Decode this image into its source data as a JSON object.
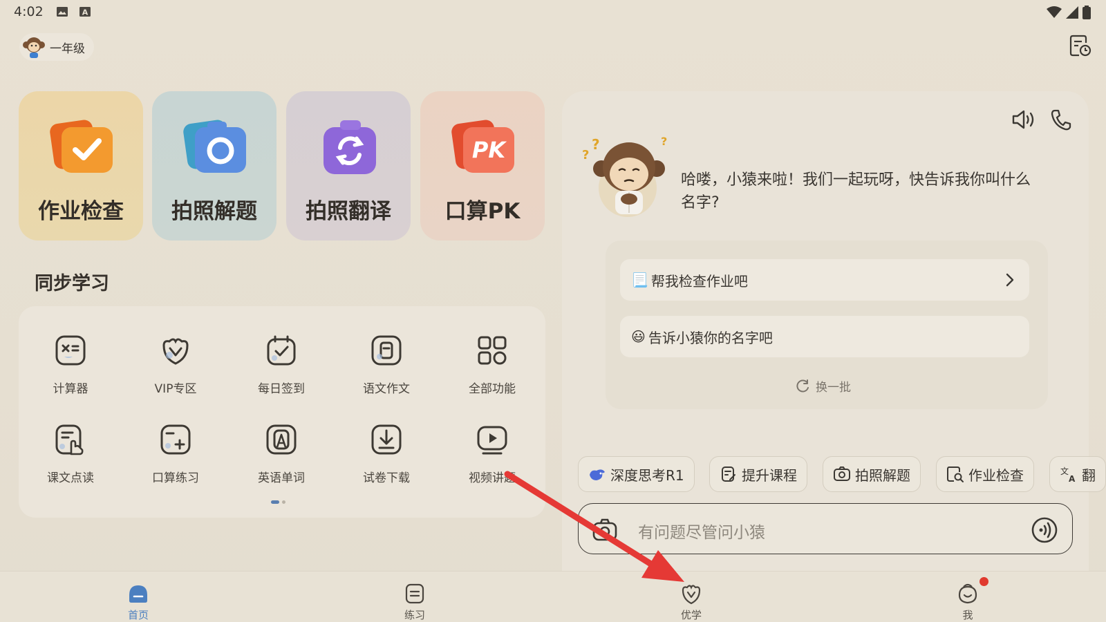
{
  "status_bar": {
    "time": "4:02"
  },
  "header": {
    "grade_label": "一年级"
  },
  "feature_cards": [
    {
      "label": "作业检查",
      "icon": "check-folder-icon",
      "color": "#f08a2a"
    },
    {
      "label": "拍照解题",
      "icon": "camera-icon",
      "color": "#4f8ad6"
    },
    {
      "label": "拍照翻译",
      "icon": "camera-refresh-icon",
      "color": "#9a6fd8"
    },
    {
      "label": "口算PK",
      "icon": "pk-icon",
      "color": "#f0745a",
      "badge_text": "PK"
    }
  ],
  "sync": {
    "title": "同步学习",
    "items": [
      {
        "label": "计算器",
        "icon": "calculator-icon"
      },
      {
        "label": "VIP专区",
        "icon": "vip-icon"
      },
      {
        "label": "每日签到",
        "icon": "calendar-check-icon"
      },
      {
        "label": "语文作文",
        "icon": "essay-icon"
      },
      {
        "label": "全部功能",
        "icon": "grid-apps-icon"
      },
      {
        "label": "课文点读",
        "icon": "read-aloud-icon"
      },
      {
        "label": "口算练习",
        "icon": "plus-box-icon"
      },
      {
        "label": "英语单词",
        "icon": "letter-a-icon"
      },
      {
        "label": "试卷下载",
        "icon": "download-icon"
      },
      {
        "label": "视频讲题",
        "icon": "video-icon"
      }
    ]
  },
  "chat": {
    "greeting": "哈喽，小猿来啦！我们一起玩呀，快告诉我你叫什么名字?",
    "suggestions": [
      {
        "emoji": "📃",
        "text": "帮我检查作业吧"
      },
      {
        "emoji": "😃",
        "text": "告诉小猿你的名字吧"
      }
    ],
    "refresh_label": "换一批",
    "chips": [
      {
        "label": "深度思考R1",
        "icon": "deepseek-icon"
      },
      {
        "label": "提升课程",
        "icon": "course-icon"
      },
      {
        "label": "拍照解题",
        "icon": "camera-icon"
      },
      {
        "label": "作业检查",
        "icon": "doc-search-icon"
      },
      {
        "label": "翻",
        "icon": "translate-icon"
      }
    ],
    "input_placeholder": "有问题尽管问小猿"
  },
  "tabs": [
    {
      "label": "首页",
      "icon": "home-icon",
      "active": true
    },
    {
      "label": "练习",
      "icon": "practice-icon",
      "active": false
    },
    {
      "label": "优学",
      "icon": "youxue-icon",
      "active": false
    },
    {
      "label": "我",
      "icon": "profile-icon",
      "active": false,
      "has_badge": true
    }
  ],
  "annotation": {
    "color": "#e53935"
  }
}
